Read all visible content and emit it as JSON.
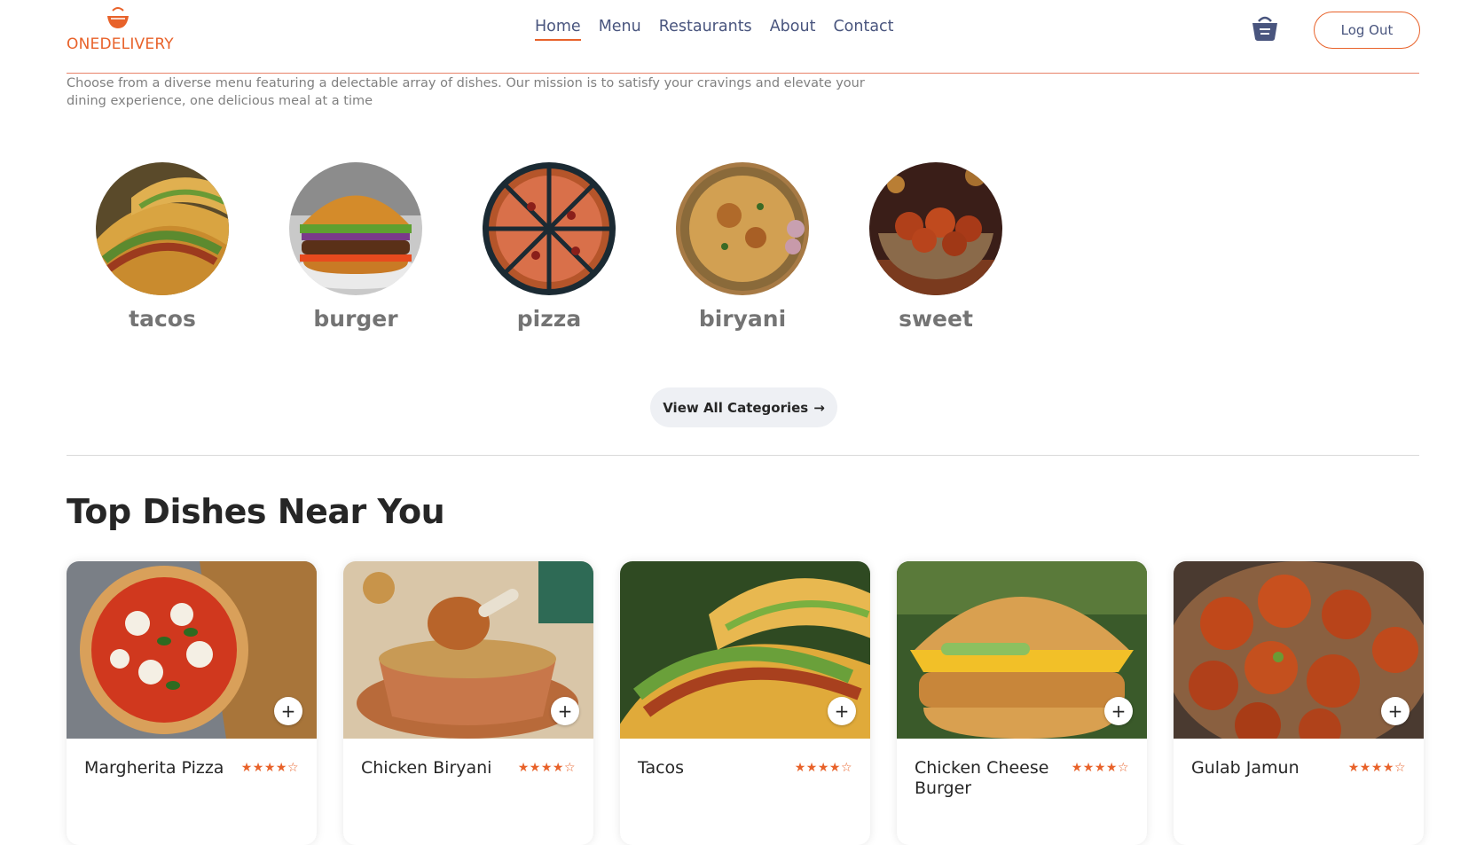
{
  "brand": {
    "name": "ONEDELIVERY",
    "color": "#e8622a"
  },
  "nav": {
    "items": [
      {
        "label": "Home",
        "active": true
      },
      {
        "label": "Menu",
        "active": false
      },
      {
        "label": "Restaurants",
        "active": false
      },
      {
        "label": "About",
        "active": false
      },
      {
        "label": "Contact",
        "active": false
      }
    ]
  },
  "header": {
    "basket_icon": "basket-icon",
    "logout_label": "Log Out"
  },
  "tagline": "Choose from a diverse menu featuring a delectable array of dishes. Our mission is to satisfy your cravings and elevate your dining experience, one delicious meal at a time",
  "categories": [
    {
      "label": "tacos",
      "icon": "tacos-image"
    },
    {
      "label": "burger",
      "icon": "burger-image"
    },
    {
      "label": "pizza",
      "icon": "pizza-image"
    },
    {
      "label": "biryani",
      "icon": "biryani-image"
    },
    {
      "label": "sweet",
      "icon": "sweet-image"
    }
  ],
  "view_all": {
    "label": "View All Categories",
    "arrow": "→"
  },
  "section_title": "Top Dishes Near You",
  "dishes": [
    {
      "name": "Margherita Pizza",
      "rating": 4,
      "stars": "★★★★☆",
      "add": "+"
    },
    {
      "name": "Chicken Biryani",
      "rating": 4,
      "stars": "★★★★☆",
      "add": "+"
    },
    {
      "name": "Tacos",
      "rating": 4,
      "stars": "★★★★☆",
      "add": "+"
    },
    {
      "name": "Chicken Cheese Burger",
      "rating": 4,
      "stars": "★★★★☆",
      "add": "+"
    },
    {
      "name": "Gulab Jamun",
      "rating": 4,
      "stars": "★★★★☆",
      "add": "+"
    }
  ]
}
